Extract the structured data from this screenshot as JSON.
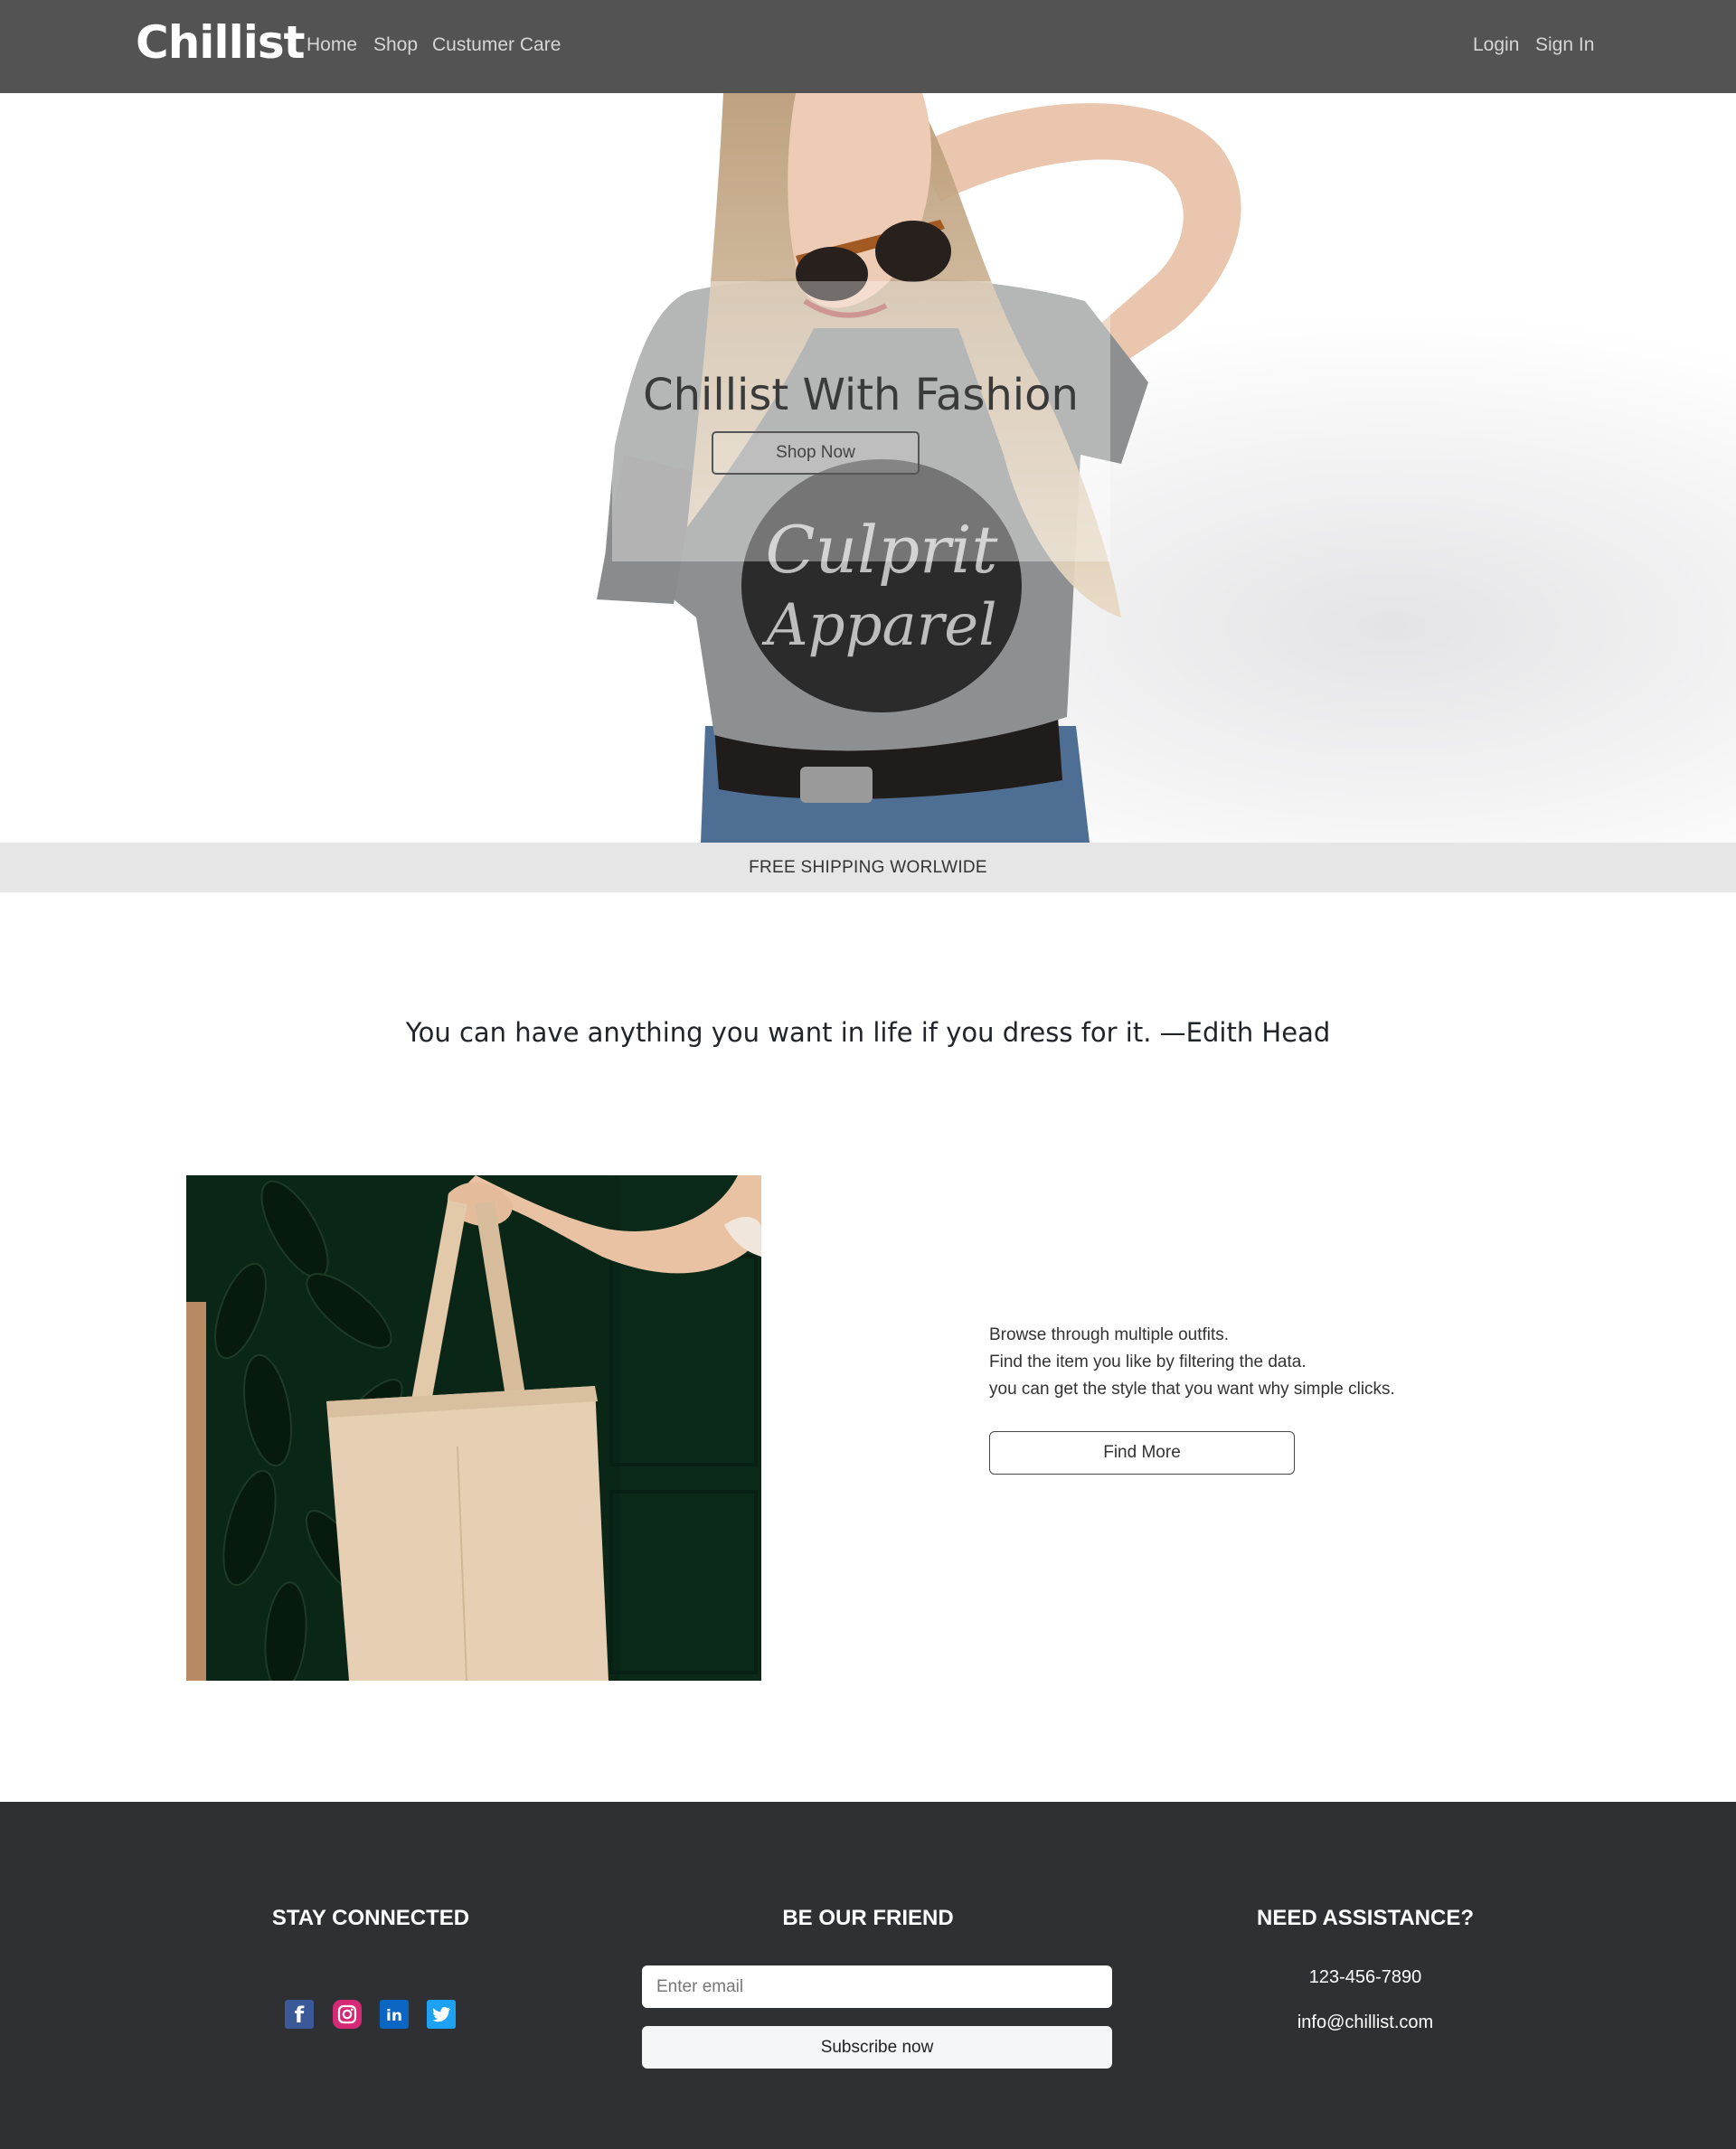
{
  "nav": {
    "brand": "Chillist",
    "links": [
      "Home",
      "Shop",
      "Custumer Care"
    ],
    "auth": [
      "Login",
      "Sign In"
    ]
  },
  "hero": {
    "title": "Chillist With Fashion",
    "button": "Shop Now",
    "shirt_text": [
      "Culprit",
      "Apparel"
    ]
  },
  "shipping": "FREE SHIPPING WORLWIDE",
  "quote": "You can have anything you want in life if you dress for it. —Edith Head",
  "feature": {
    "lines": [
      "Browse through multiple outfits.",
      "Find the item you like by filtering the data.",
      "you can get the style that you want why simple clicks."
    ],
    "button": "Find More"
  },
  "footer": {
    "stay_connected": "STAY CONNECTED",
    "be_our_friend": "BE OUR FRIEND",
    "need_assistance": "NEED ASSISTANCE?",
    "email_placeholder": "Enter email",
    "subscribe": "Subscribe now",
    "phone": "123-456-7890",
    "email": "info@chillist.com",
    "social_icons": [
      "facebook-icon",
      "instagram-icon",
      "linkedin-icon",
      "twitter-icon"
    ]
  },
  "colors": {
    "navbar": "#535353",
    "footer": "#2f3033",
    "shipping_bar": "#e6e6e6",
    "facebook": "#3b5998",
    "instagram": "#d62976",
    "linkedin": "#0a66c2",
    "twitter": "#1da1f2"
  }
}
